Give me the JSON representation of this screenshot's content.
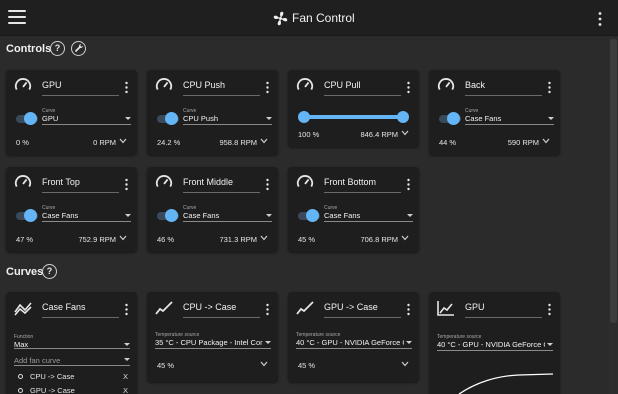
{
  "app": {
    "title": "Fan Control"
  },
  "colors": {
    "accent": "#64b5f6",
    "card": "#1e1e1e",
    "background": "#2b2b2b",
    "topbar": "#1f1f1f"
  },
  "sections": {
    "controls": "Controls",
    "curves": "Curves"
  },
  "icons": {
    "help": "?",
    "menu": "menu-icon",
    "fan": "fan-icon",
    "wrench": "wrench-icon",
    "gauge": "gauge-icon",
    "more": "more-vert-icon"
  },
  "controls": [
    {
      "name": "GPU",
      "curve_label": "Curve",
      "curve": "GPU",
      "percent": "0 %",
      "rpm": "0 RPM",
      "toggle_on": true
    },
    {
      "name": "CPU Push",
      "curve_label": "Curve",
      "curve": "CPU Push",
      "percent": "24.2 %",
      "rpm": "958.8 RPM",
      "toggle_on": true
    },
    {
      "name": "CPU Pull",
      "percent": "100 %",
      "rpm": "846.4 RPM",
      "range": [
        0,
        100
      ]
    },
    {
      "name": "Back",
      "curve_label": "Curve",
      "curve": "Case Fans",
      "percent": "44 %",
      "rpm": "590 RPM",
      "toggle_on": true
    },
    {
      "name": "Front Top",
      "curve_label": "Curve",
      "curve": "Case Fans",
      "percent": "47 %",
      "rpm": "752.9 RPM",
      "toggle_on": true
    },
    {
      "name": "Front Middle",
      "curve_label": "Curve",
      "curve": "Case Fans",
      "percent": "46 %",
      "rpm": "731.3 RPM",
      "toggle_on": true
    },
    {
      "name": "Front Bottom",
      "curve_label": "Curve",
      "curve": "Case Fans",
      "percent": "45 %",
      "rpm": "706.8 RPM",
      "toggle_on": true
    }
  ],
  "curves": [
    {
      "name": "Case Fans",
      "function_label": "Function",
      "function": "Max",
      "add_placeholder": "Add fan curve",
      "items": [
        {
          "label": "CPU -> Case",
          "remove": "X"
        },
        {
          "label": "GPU -> Case",
          "remove": "X"
        }
      ]
    },
    {
      "name": "CPU -> Case",
      "source_label": "Temperature source",
      "source": "35 °C - CPU Package - Intel Core i5",
      "percent": "45 %"
    },
    {
      "name": "GPU -> Case",
      "source_label": "Temperature source",
      "source": "40 °C - GPU - NVIDIA GeForce GTX",
      "percent": "45 %"
    },
    {
      "name": "GPU",
      "source_label": "Temperature source",
      "source": "40 °C - GPU - NVIDIA GeForce GTX"
    }
  ]
}
